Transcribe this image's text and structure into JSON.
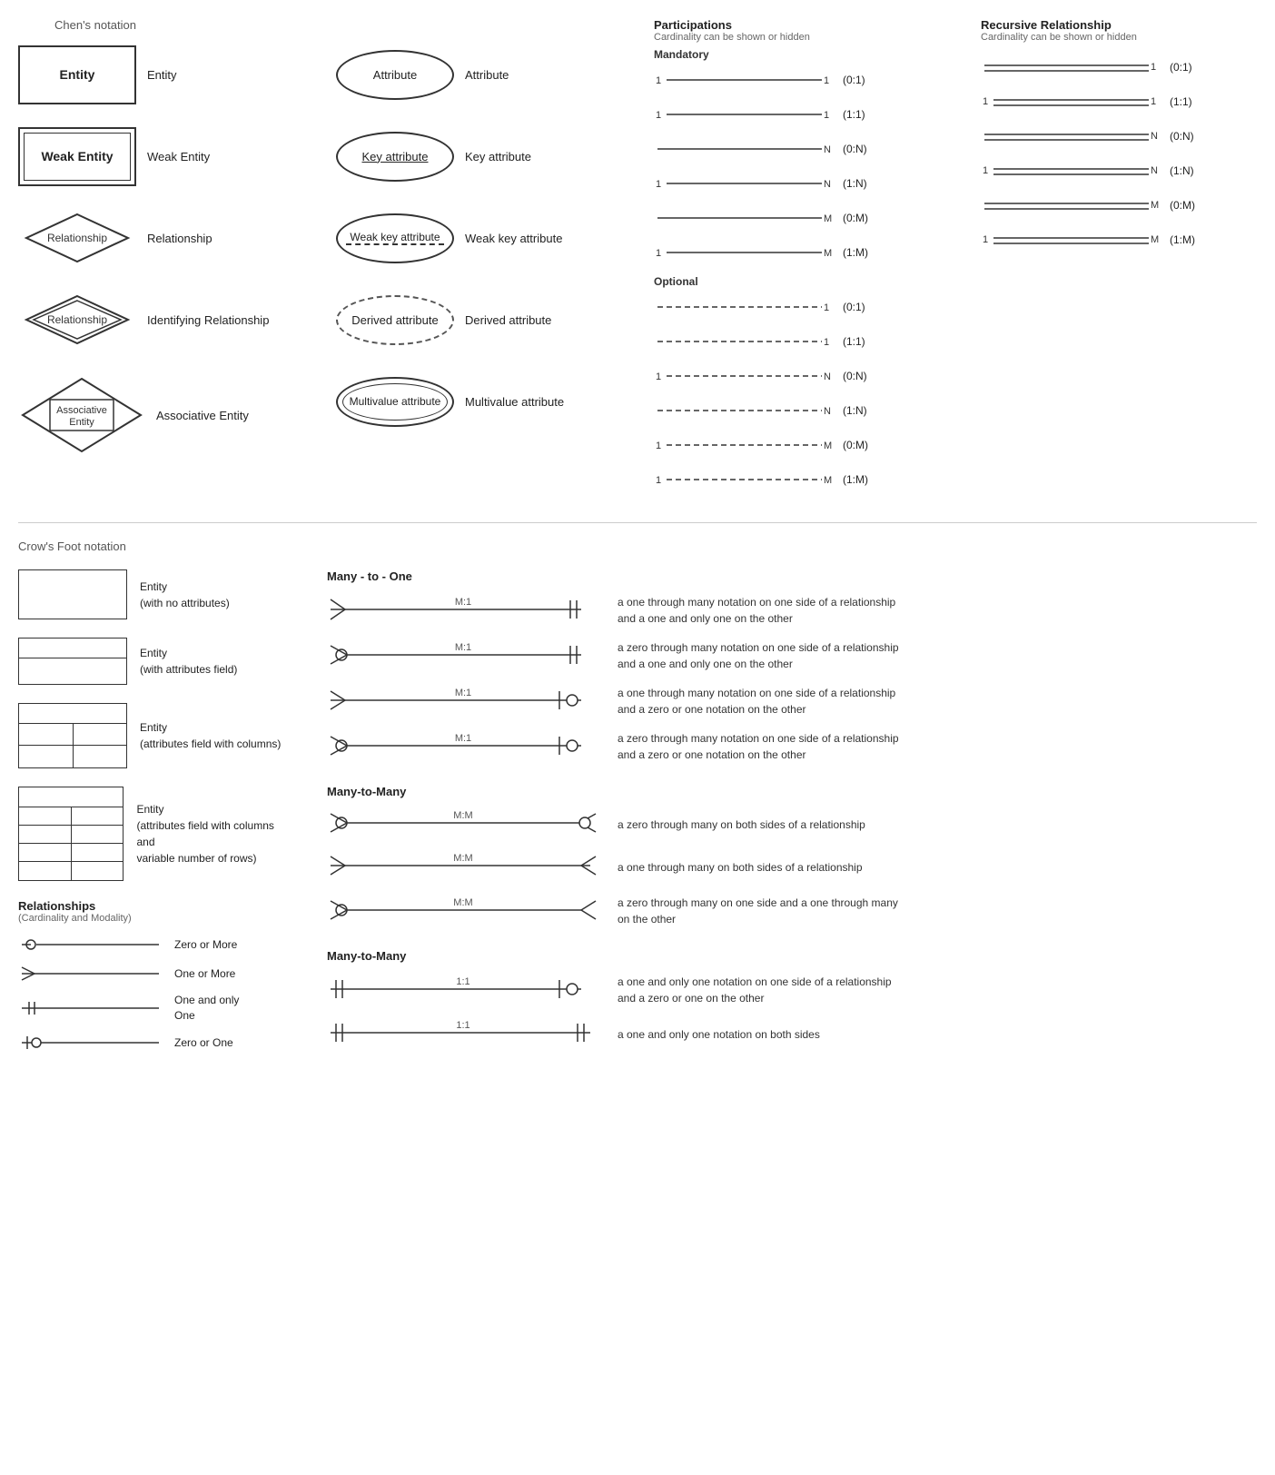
{
  "chens": {
    "header": "Chen's notation",
    "items": [
      {
        "symbol": "entity",
        "label": "Entity",
        "symbol_text": "Entity"
      },
      {
        "symbol": "weak_entity",
        "label": "Weak Entity",
        "symbol_text": "Weak Entity"
      },
      {
        "symbol": "relationship",
        "label": "Relationship",
        "symbol_text": "Relationship"
      },
      {
        "symbol": "identifying_relationship",
        "label": "Identifying Relationship",
        "symbol_text": "Relationship"
      },
      {
        "symbol": "associative_entity",
        "label": "Associative Entity",
        "symbol_text": "Associative\nEntity"
      }
    ],
    "attributes": [
      {
        "symbol": "attribute",
        "label": "Attribute",
        "symbol_text": "Attribute"
      },
      {
        "symbol": "key_attribute",
        "label": "Key attribute",
        "symbol_text": "Key attribute"
      },
      {
        "symbol": "weak_key_attribute",
        "label": "Weak key attribute",
        "symbol_text": "Weak key attribute"
      },
      {
        "symbol": "derived_attribute",
        "label": "Derived attribute",
        "symbol_text": "Derived attribute"
      },
      {
        "symbol": "multivalue_attribute",
        "label": "Multivalue attribute",
        "symbol_text": "Multivalue attribute"
      }
    ]
  },
  "participations": {
    "title": "Participations",
    "subtitle": "Cardinality can be shown or hidden",
    "mandatory_label": "Mandatory",
    "optional_label": "Optional",
    "mandatory_rows": [
      {
        "left": "1",
        "right": "1",
        "notation": "(0:1)"
      },
      {
        "left": "1",
        "right": "1",
        "notation": "(1:1)"
      },
      {
        "left": "",
        "right": "N",
        "notation": "(0:N)"
      },
      {
        "left": "1",
        "right": "N",
        "notation": "(1:N)"
      },
      {
        "left": "",
        "right": "M",
        "notation": "(0:M)"
      },
      {
        "left": "1",
        "right": "M",
        "notation": "(1:M)"
      }
    ],
    "optional_rows": [
      {
        "left": "",
        "right": "1",
        "notation": "(0:1)"
      },
      {
        "left": "",
        "right": "1",
        "notation": "(1:1)"
      },
      {
        "left": "1",
        "right": "N",
        "notation": "(0:N)"
      },
      {
        "left": "",
        "right": "N",
        "notation": "(1:N)"
      },
      {
        "left": "1",
        "right": "M",
        "notation": "(0:M)"
      },
      {
        "left": "1",
        "right": "M",
        "notation": "(1:M)"
      }
    ]
  },
  "recursive": {
    "title": "Recursive Relationship",
    "subtitle": "Cardinality can be shown or hidden",
    "rows": [
      {
        "right": "1",
        "notation": "(0:1)"
      },
      {
        "left": "1",
        "right": "1",
        "notation": "(1:1)"
      },
      {
        "right": "N",
        "notation": "(0:N)"
      },
      {
        "left": "1",
        "right": "N",
        "notation": "(1:N)"
      },
      {
        "right": "M",
        "notation": "(0:M)"
      },
      {
        "left": "1",
        "right": "M",
        "notation": "(1:M)"
      }
    ]
  },
  "crows": {
    "header": "Crow's Foot notation",
    "entities": [
      {
        "type": "simple",
        "label": "Entity\n(with no attributes)"
      },
      {
        "type": "attr",
        "label": "Entity\n(with attributes field)"
      },
      {
        "type": "columns",
        "label": "Entity\n(attributes field with columns)"
      },
      {
        "type": "variable",
        "label": "Entity\n(attributes field with columns and\nvariable number of rows)"
      }
    ],
    "many_to_one": {
      "title": "Many - to - One",
      "rows": [
        {
          "label": "M:1",
          "desc": "a one through many notation on one side of a relationship\nand a one and only one on the other"
        },
        {
          "label": "M:1",
          "desc": "a zero through many notation on one side of a relationship\nand a one and only one on the other"
        },
        {
          "label": "M:1",
          "desc": "a one through many notation on one side of a relationship\nand a zero or one notation on the other"
        },
        {
          "label": "M:1",
          "desc": "a zero through many notation on one side of a relationship\nand a zero or one notation on the other"
        }
      ]
    },
    "many_to_many": {
      "title": "Many-to-Many",
      "rows": [
        {
          "label": "M:M",
          "desc": "a zero through many on both sides of a relationship"
        },
        {
          "label": "M:M",
          "desc": "a one through many on both sides of a relationship"
        },
        {
          "label": "M:M",
          "desc": "a zero through many on one side and a one through many\non the other"
        }
      ]
    },
    "one_to_one": {
      "title": "Many-to-Many",
      "rows": [
        {
          "label": "1:1",
          "desc": "a one and only one notation on one side of a relationship\nand a zero or one on the other"
        },
        {
          "label": "1:1",
          "desc": "a one and only one notation on both sides"
        }
      ]
    },
    "relationships": {
      "title": "Relationships",
      "subtitle": "(Cardinality and Modality)",
      "items": [
        {
          "type": "zero_more",
          "label": "Zero or More"
        },
        {
          "type": "one_more",
          "label": "One or More"
        },
        {
          "type": "one_only",
          "label": "One and only\nOne"
        },
        {
          "type": "zero_one",
          "label": "Zero or One"
        }
      ]
    }
  }
}
